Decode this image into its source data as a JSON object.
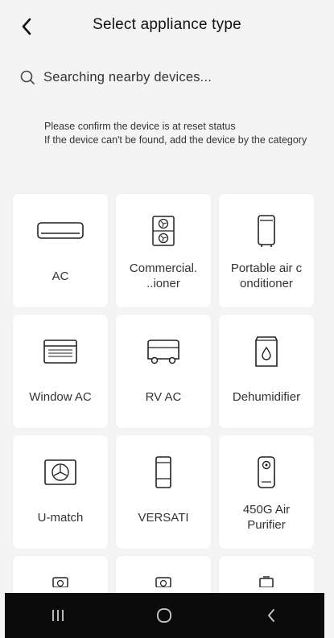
{
  "header": {
    "title": "Select appliance type",
    "back_icon": "chevron-left-icon"
  },
  "search": {
    "text": "Searching nearby devices...",
    "icon": "search-icon"
  },
  "notice": {
    "text": "Please confirm the device is at reset status\n If the device can't be found, add the device by the category"
  },
  "appliances": [
    {
      "label": "AC",
      "icon": "split-ac-icon"
    },
    {
      "label": "Commercial.\n..ioner",
      "icon": "commercial-ac-icon"
    },
    {
      "label": "Portable air c\nonditioner",
      "icon": "portable-ac-icon"
    },
    {
      "label": "Window AC",
      "icon": "window-ac-icon"
    },
    {
      "label": "RV AC",
      "icon": "rv-ac-icon"
    },
    {
      "label": "Dehumidifier",
      "icon": "dehumidifier-icon"
    },
    {
      "label": "U-match",
      "icon": "umatch-fan-icon"
    },
    {
      "label": "VERSATI",
      "icon": "versati-icon"
    },
    {
      "label": "450G Air\nPurifier",
      "icon": "air-purifier-icon"
    }
  ],
  "navbar": {
    "recents_icon": "recents-icon",
    "home_icon": "home-icon",
    "back_icon": "nav-back-icon"
  }
}
